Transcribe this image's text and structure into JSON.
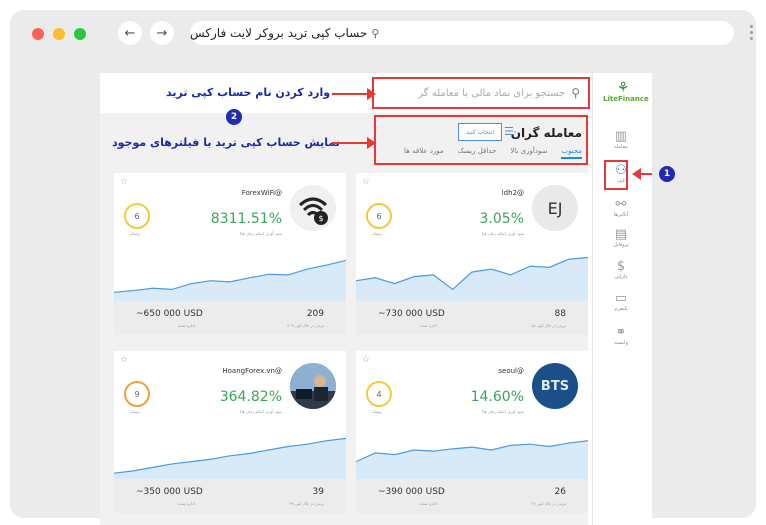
{
  "browser": {
    "url_text": "حساب کپی ترید بروکر لایت فارکس",
    "dot_colors": [
      "#ff5f57",
      "#febc2e",
      "#28c840"
    ],
    "back_icon": "arrow-left-icon",
    "forward_icon": "arrow-right-icon"
  },
  "search": {
    "placeholder": "جستجو برای نماد مالی یا معامله گر"
  },
  "filters": {
    "title": "معامله گران",
    "select_label": "انتخاب کنید",
    "tabs": [
      "محبوب",
      "سودآوری بالا",
      "حداقل ریسک",
      "مورد علاقه ها"
    ]
  },
  "annotations": {
    "search_note": "وارد کردن نام حساب کپی ترید",
    "filter_note": "نمایش حساب کپی ترید با فیلترهای موجود",
    "badge_1": "1",
    "badge_2": "2"
  },
  "sidebar": {
    "logo": "LiteFinance",
    "items": [
      {
        "label": "معامله",
        "icon": "bar-chart-icon"
      },
      {
        "label": "کپی",
        "icon": "copy-users-icon"
      },
      {
        "label": "آنالیزها",
        "icon": "analytics-icon"
      },
      {
        "label": "پروفایل",
        "icon": "profile-card-icon"
      },
      {
        "label": "دارایی",
        "icon": "dollar-icon"
      },
      {
        "label": "پلتفرم",
        "icon": "monitor-icon"
      },
      {
        "label": "وابسته",
        "icon": "partner-icon"
      }
    ]
  },
  "cards": [
    {
      "name": "ForexWiFi@",
      "risk": "6",
      "risk_label": "ریسک",
      "profit": "8311.51%",
      "profit_label": "سود آوری (تمام زمان ها)",
      "funds": "~650 000 USD",
      "funds_label": "اداره شده",
      "copiers": "209",
      "copiers_label": "۲۰۹ تریدر در حال کپی",
      "avatar_text": "",
      "chart": [
        0.15,
        0.18,
        0.22,
        0.2,
        0.3,
        0.35,
        0.33,
        0.4,
        0.46,
        0.45,
        0.55,
        0.62,
        0.7
      ]
    },
    {
      "name": "ldh2@",
      "risk": "6",
      "risk_label": "ریسک",
      "profit": "3.05%",
      "profit_label": "سود آوری (تمام زمان ها)",
      "funds": "~730 000 USD",
      "funds_label": "اداره شده",
      "copiers": "88",
      "copiers_label": "۸۸ تریدر در حال کپی",
      "avatar_text": "EJ",
      "chart": [
        0.35,
        0.4,
        0.3,
        0.42,
        0.45,
        0.2,
        0.5,
        0.55,
        0.45,
        0.6,
        0.58,
        0.72,
        0.75
      ]
    },
    {
      "name": "HoangForex.vn@",
      "risk": "9",
      "risk_label": "ریسک",
      "profit": "364.82%",
      "profit_label": "سود آوری (تمام زمان ها)",
      "funds": "~350 000 USD",
      "funds_label": "اداره شده",
      "copiers": "39",
      "copiers_label": "۳۹ تریدر در حال کپی",
      "avatar_text": "",
      "chart": [
        0.1,
        0.14,
        0.2,
        0.26,
        0.3,
        0.34,
        0.4,
        0.44,
        0.5,
        0.56,
        0.6,
        0.66,
        0.7
      ]
    },
    {
      "name": "seoul@",
      "risk": "4",
      "risk_label": "ریسک",
      "profit": "14.60%",
      "profit_label": "سود آوری (تمام زمان ها)",
      "funds": "~390 000 USD",
      "funds_label": "اداره شده",
      "copiers": "26",
      "copiers_label": "۲۶ تریدر در حال کپی",
      "avatar_text": "BTS",
      "chart": [
        0.3,
        0.45,
        0.42,
        0.5,
        0.48,
        0.52,
        0.55,
        0.5,
        0.58,
        0.6,
        0.56,
        0.62,
        0.66
      ]
    }
  ]
}
